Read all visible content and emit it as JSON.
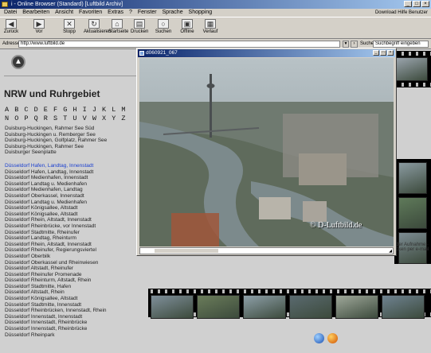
{
  "window": {
    "title": "i - Online Browser (Standard) [Luftbild Archiv]"
  },
  "menu": {
    "items": [
      "Datei",
      "Bearbeiten",
      "Ansicht",
      "Favoriten",
      "Extras",
      "?",
      "Fenster",
      "Sprache",
      "Shopping"
    ],
    "right": "Download   Hilfe   Benutzer"
  },
  "toolbar": {
    "buttons": [
      {
        "label": "Zurück",
        "icon": "back-arrow-icon"
      },
      {
        "label": "Vor",
        "icon": "forward-arrow-icon"
      },
      {
        "label": "Stopp",
        "icon": "stop-icon"
      },
      {
        "label": "Aktualisieren",
        "icon": "refresh-icon"
      },
      {
        "label": "Startseite",
        "icon": "home-icon"
      },
      {
        "label": "Drucken",
        "icon": "print-icon"
      },
      {
        "label": "Suchen",
        "icon": "search-icon"
      },
      {
        "label": "Offline",
        "icon": "offline-icon"
      },
      {
        "label": "Verlauf",
        "icon": "history-icon"
      }
    ]
  },
  "address": {
    "label": "Adresse",
    "value": "http://www.luftbild.de",
    "search_label": "Suche",
    "search_value": "Suchbegriff eingeben"
  },
  "page": {
    "heading": "NRW und Ruhrgebiet",
    "alphabet_row1": "A B C D E F G H I J K L M",
    "alphabet_row2": "N O P Q R S T U V W X Y Z",
    "list_a": [
      "Duisburg-Huckingen, Rahmer See Süd",
      "Duisburg-Huckingen u. Remberger See",
      "Duisburg-Huckingen, Golfplatz, Rahmer See",
      "Duisburg-Huckingen, Rahmer See",
      "Duisburger Seenplatte"
    ],
    "list_b": [
      "Düsseldorf Hafen, Landtag, Innenstadt",
      "Düsseldorf Hafen, Landtag, Innenstadt",
      "Düsseldorf Medienhafen, Innenstadt",
      "Düsseldorf Landtag u. Medienhafen",
      "Düsseldorf Medienhafen, Landtag",
      "Düsseldorf Oberkassel, Innenstadt",
      "Düsseldorf Landtag u. Medienhafen",
      "Düsseldorf Königsallee, Altstadt",
      "Düsseldorf Königsallee, Altstadt",
      "Düsseldorf Rhein, Altstadt, Innenstadt",
      "Düsseldorf Rheinbrücke, vor Innenstadt",
      "Düsseldorf Stadtmitte, Rheinufer",
      "Düsseldorf Landtag, Rheinturm",
      "Düsseldorf Rhein, Altstadt, Innenstadt",
      "Düsseldorf Rheinufer, Regierungsviertel",
      "Düsseldorf Oberbilk",
      "Düsseldorf Oberkassel und Rheinwiesen",
      "Düsseldorf Altstadt, Rheinufer",
      "Düsseldorf Rheinufer Promenade",
      "Düsseldorf Rheinturm, Altstadt, Rhein",
      "Düsseldorf Stadtmitte, Hafen",
      "Düsseldorf Altstadt, Rhein",
      "Düsseldorf Königsallee, Altstadt",
      "Düsseldorf Stadtmitte, Innenstadt",
      "Düsseldorf Rheinbrücken, Innenstadt, Rhein",
      "Düsseldorf Innenstadt, Innenstadt",
      "Düsseldorf Innenstadt, Rheinbrücke",
      "Düsseldorf Innenstadt, Rheinbrücke",
      "Düsseldorf Rheinpark"
    ],
    "right_caption": "der Aufnahme · cken per e-mail"
  },
  "popup": {
    "title": "d060921_067",
    "watermark": "© D-Luftbild.de"
  },
  "film_top_colors": [
    "#6b8a9a",
    "#7a8c6a",
    "#5c6e7a",
    "#a8b0a8",
    "#4f6a4a",
    "#8a9a9f",
    "#6a7d60",
    "#9aa4ad"
  ],
  "film_bottom_colors": [
    "#7f8f9a",
    "#6a7c5a",
    "#8d9fa8",
    "#5a6a6f",
    "#9fa89a",
    "#6e8290"
  ],
  "film_right_colors": [
    "#8a9aa0",
    "#5f7a5a",
    "#7d8c93"
  ]
}
